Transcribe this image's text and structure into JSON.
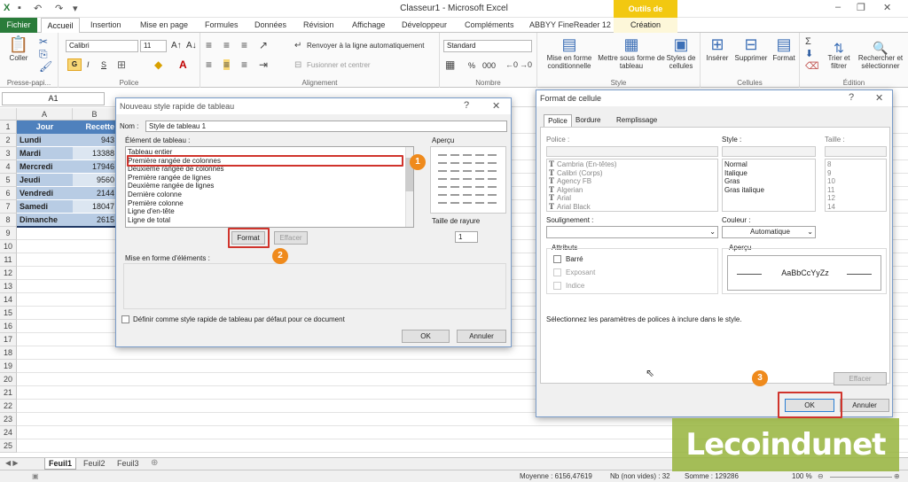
{
  "app": {
    "title": "Classeur1 - Microsoft Excel",
    "context_tools": "Outils de tableau",
    "colors": {
      "file_tab": "#2a7c3a",
      "context": "#f2c811",
      "header_cell": "#4f81bd",
      "band": "#b8cce4",
      "accent": "#d0342c",
      "badge": "#ef8a1c"
    }
  },
  "tabs": {
    "file": "Fichier",
    "home": "Accueil",
    "insert": "Insertion",
    "layout": "Mise en page",
    "formulas": "Formules",
    "data": "Données",
    "review": "Révision",
    "view": "Affichage",
    "developer": "Développeur",
    "addins": "Compléments",
    "abbyy": "ABBYY FineReader 12",
    "create": "Création"
  },
  "ribbon": {
    "clipboard": {
      "label": "Presse-papi...",
      "paste": "Coller"
    },
    "font": {
      "label": "Police",
      "name": "Calibri",
      "size": "11",
      "bold": "G",
      "italic": "I",
      "underline": "S"
    },
    "alignment": {
      "label": "Alignement",
      "wrap": "Renvoyer à la ligne automatiquement",
      "merge": "Fusionner et centrer"
    },
    "number": {
      "label": "Nombre",
      "format": "Standard",
      "percent": "%",
      "thousands": "000"
    },
    "styles": {
      "label": "Style",
      "conditional": "Mise en forme conditionnelle",
      "table": "Mettre sous forme de tableau",
      "cells": "Styles de cellules"
    },
    "cells": {
      "label": "Cellules",
      "insert": "Insérer",
      "delete": "Supprimer",
      "format": "Format"
    },
    "editing": {
      "label": "Édition",
      "sort": "Trier et filtrer",
      "find": "Rechercher et sélectionner"
    }
  },
  "formula_bar": {
    "name_box": "A1"
  },
  "sheet": {
    "columns": [
      "A",
      "B"
    ],
    "rows": [
      "1",
      "2",
      "3",
      "4",
      "5",
      "6",
      "7",
      "8",
      "9",
      "10",
      "11",
      "12",
      "13",
      "14",
      "15",
      "16",
      "17",
      "18",
      "19",
      "20",
      "21",
      "22",
      "23",
      "24",
      "25"
    ],
    "header": {
      "jour": "Jour",
      "recettes": "Recette"
    },
    "data": [
      {
        "jour": "Lundi",
        "val": "943"
      },
      {
        "jour": "Mardi",
        "val": "13388"
      },
      {
        "jour": "Mercredi",
        "val": "17946"
      },
      {
        "jour": "Jeudi",
        "val": "9560"
      },
      {
        "jour": "Vendredi",
        "val": "2144"
      },
      {
        "jour": "Samedi",
        "val": "18047"
      },
      {
        "jour": "Dimanche",
        "val": "2615"
      }
    ],
    "tabs": [
      "Feuil1",
      "Feuil2",
      "Feuil3"
    ]
  },
  "status": {
    "average": "Moyenne : 6156,47619",
    "count": "Nb (non vides) : 32",
    "sum": "Somme : 129286",
    "zoom": "100 %"
  },
  "dialog_style": {
    "title": "Nouveau style rapide de tableau",
    "help": "?",
    "name_label": "Nom :",
    "name_value": "Style de tableau 1",
    "element_label": "Élément de tableau :",
    "elements": [
      "Tableau entier",
      "Première rangée de colonnes",
      "Deuxième rangée de colonnes",
      "Première rangée de lignes",
      "Deuxième rangée de lignes",
      "Dernière colonne",
      "Première colonne",
      "Ligne d'en-tête",
      "Ligne de total"
    ],
    "preview_label": "Aperçu",
    "stripe_label": "Taille de rayure",
    "stripe_value": "1",
    "format_btn": "Format",
    "clear_btn": "Effacer",
    "formatting_label": "Mise en forme d'éléments :",
    "default_check": "Définir comme style rapide de tableau par défaut pour ce document",
    "ok": "OK",
    "cancel": "Annuler"
  },
  "dialog_format": {
    "title": "Format de cellule",
    "help": "?",
    "tabs": [
      "Police",
      "Bordure",
      "Remplissage"
    ],
    "font_label": "Police :",
    "fonts": [
      "Cambria (En-têtes)",
      "Calibri (Corps)",
      "Agency FB",
      "Algerian",
      "Arial",
      "Arial Black"
    ],
    "style_label": "Style :",
    "styles": [
      "Normal",
      "Italique",
      "Gras",
      "Gras italique"
    ],
    "size_label": "Taille :",
    "sizes": [
      "8",
      "9",
      "10",
      "11",
      "12",
      "14"
    ],
    "underline_label": "Soulignement :",
    "color_label": "Couleur :",
    "color_value": "Automatique",
    "attributes_label": "Attributs",
    "attr_strike": "Barré",
    "attr_super": "Exposant",
    "attr_sub": "Indice",
    "preview_label": "Aperçu",
    "preview_text": "AaBbCcYyZz",
    "hint": "Sélectionnez les paramètres de polices à inclure dans le style.",
    "clear_btn": "Effacer",
    "ok": "OK",
    "cancel": "Annuler"
  },
  "callouts": [
    "1",
    "2",
    "3"
  ],
  "watermark": {
    "text": "Lecoindunet"
  }
}
